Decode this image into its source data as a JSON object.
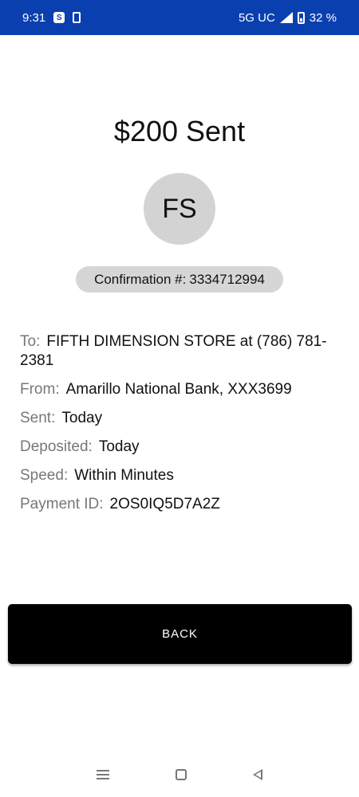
{
  "status_bar": {
    "time": "9:31",
    "s_icon": "S",
    "network": "5G UC",
    "battery": "32 %"
  },
  "payment": {
    "title": "$200 Sent",
    "avatar_initials": "FS",
    "confirmation_label": "Confirmation #:",
    "confirmation_number": "3334712994",
    "details": {
      "to": {
        "label": "To:",
        "value": "FIFTH DIMENSION STORE at (786) 781-2381"
      },
      "from": {
        "label": "From:",
        "value": "Amarillo National Bank, XXX3699"
      },
      "sent": {
        "label": "Sent:",
        "value": "Today"
      },
      "deposited": {
        "label": "Deposited:",
        "value": "Today"
      },
      "speed": {
        "label": "Speed:",
        "value": "Within Minutes"
      },
      "payment_id": {
        "label": "Payment ID:",
        "value": "2OS0IQ5D7A2Z"
      }
    },
    "back_label": "BACK"
  }
}
